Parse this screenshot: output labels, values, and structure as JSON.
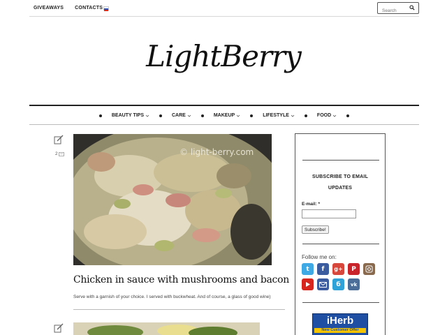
{
  "topnav": {
    "items": [
      "GIVEAWAYS",
      "CONTACTS"
    ]
  },
  "search": {
    "placeholder": "Search"
  },
  "logo": "LightBerry",
  "mainnav": {
    "items": [
      "BEAUTY TIPS",
      "CARE",
      "MAKEUP",
      "LIFESTYLE",
      "FOOD"
    ]
  },
  "post": {
    "comment_count": "2",
    "watermark": "© light-berry.com",
    "title": "Chicken in sauce with mushrooms and bacon",
    "excerpt": "Serve with a garnish of your choice. I served with buckwheat. And of course, a glass of good wine)"
  },
  "sidebar": {
    "subscribe_title": "SUBSCRIBE TO EMAIL UPDATES",
    "email_label": "E-mail: *",
    "subscribe_button": "Subscribe!",
    "follow_label": "Follow me on:",
    "social": [
      {
        "icon": "twitter-icon",
        "color": "#3fa9e6"
      },
      {
        "icon": "facebook-icon",
        "color": "#3b5c9f"
      },
      {
        "icon": "google-plus-icon",
        "color": "#d8473b"
      },
      {
        "icon": "pinterest-icon",
        "color": "#c9242b"
      },
      {
        "icon": "instagram-icon",
        "color": "#8a6a4f"
      },
      {
        "icon": "youtube-icon",
        "color": "#d8261f"
      },
      {
        "icon": "email-icon",
        "color": "#3b5c9f"
      },
      {
        "icon": "blogger-icon",
        "color": "#2fa3d8"
      },
      {
        "icon": "vk-icon",
        "color": "#4b6e98"
      }
    ],
    "iherb": {
      "brand": "iHerb",
      "offer": "New Customer Offer"
    }
  }
}
